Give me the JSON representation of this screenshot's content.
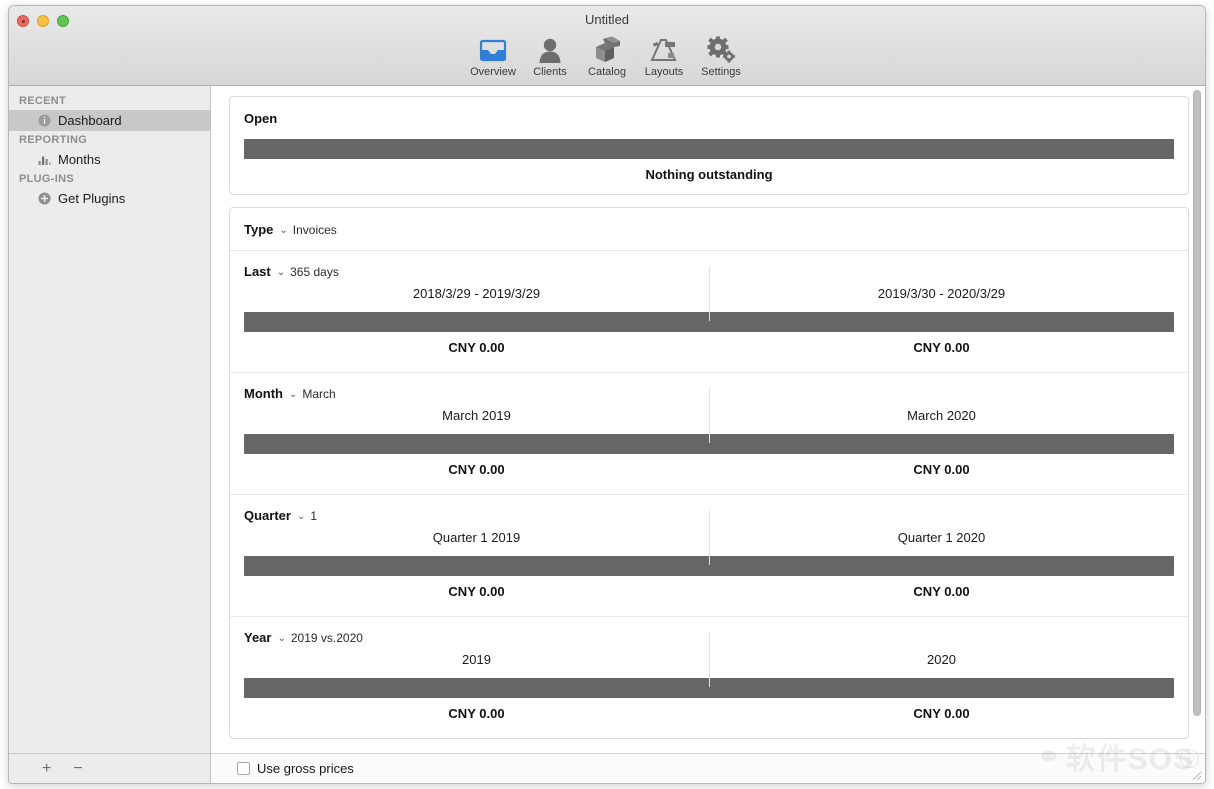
{
  "window": {
    "title": "Untitled",
    "traffic_lights": [
      "close",
      "minimize",
      "zoom"
    ]
  },
  "toolbar": {
    "items": [
      {
        "label": "Overview",
        "icon": "inbox-icon",
        "selected": true
      },
      {
        "label": "Clients",
        "icon": "person-icon",
        "selected": false
      },
      {
        "label": "Catalog",
        "icon": "boxes-icon",
        "selected": false
      },
      {
        "label": "Layouts",
        "icon": "layout-icon",
        "selected": false
      },
      {
        "label": "Settings",
        "icon": "gears-icon",
        "selected": false
      }
    ]
  },
  "sidebar": {
    "groups": [
      {
        "header": "RECENT",
        "items": [
          {
            "label": "Dashboard",
            "icon": "info-circle-icon",
            "selected": true
          }
        ]
      },
      {
        "header": "REPORTING",
        "items": [
          {
            "label": "Months",
            "icon": "bar-chart-icon",
            "selected": false
          }
        ]
      },
      {
        "header": "PLUG-INS",
        "items": [
          {
            "label": "Get Plugins",
            "icon": "plus-circle-icon",
            "selected": false
          }
        ]
      }
    ],
    "bottom": {
      "add_label": "+",
      "remove_label": "−"
    }
  },
  "open_card": {
    "title": "Open",
    "bar_color": "#666666",
    "caption": "Nothing outstanding"
  },
  "type_row": {
    "field_name": "Type",
    "chevron": "⌄",
    "value": "Invoices"
  },
  "sections": [
    {
      "field_name": "Last",
      "chevron": "⌄",
      "value": "365 days",
      "left_label": "2018/3/29 - 2019/3/29",
      "right_label": "2019/3/30 - 2020/3/29",
      "left_value": "CNY 0.00",
      "right_value": "CNY 0.00"
    },
    {
      "field_name": "Month",
      "chevron": "⌄",
      "value": "March",
      "left_label": "March 2019",
      "right_label": "March 2020",
      "left_value": "CNY 0.00",
      "right_value": "CNY 0.00"
    },
    {
      "field_name": "Quarter",
      "chevron": "⌄",
      "value": "1",
      "left_label": "Quarter 1 2019",
      "right_label": "Quarter 1 2020",
      "left_value": "CNY 0.00",
      "right_value": "CNY 0.00"
    },
    {
      "field_name": "Year",
      "chevron": "⌄",
      "value": "2019 vs.2020",
      "left_label": "2019",
      "right_label": "2020",
      "left_value": "CNY 0.00",
      "right_value": "CNY 0.00"
    }
  ],
  "footer": {
    "checkbox_label": "Use gross prices",
    "checkbox_checked": false
  },
  "watermark": {
    "text": "软件SOS",
    "badge": "®"
  },
  "colors": {
    "bar": "#666666",
    "sidebar_bg": "#ececec",
    "selected_row": "#c8c8c8",
    "accent_blue": "#2f7fd8"
  }
}
